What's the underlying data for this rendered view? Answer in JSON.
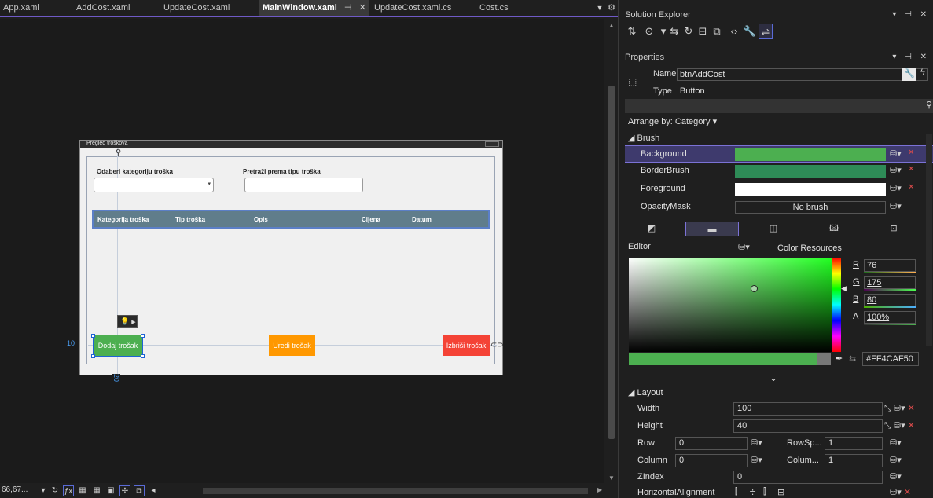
{
  "tabs": [
    {
      "label": "App.xaml"
    },
    {
      "label": "AddCost.xaml"
    },
    {
      "label": "UpdateCost.xaml"
    },
    {
      "label": "MainWindow.xaml",
      "pin": "⊣",
      "close": "✕",
      "active": true
    },
    {
      "label": "UpdateCost.xaml.cs"
    },
    {
      "label": "Cost.cs"
    }
  ],
  "designer": {
    "window_title": "Pregled troškova",
    "combo_label": "Odaberi kategoriju troška",
    "search_label": "Pretraži prema tipu troška",
    "columns": [
      "Kategorija troška",
      "Tip troška",
      "Opis",
      "Cijena",
      "Datum"
    ],
    "buttons": {
      "add": "Dodaj trošak",
      "edit": "Uredi trošak",
      "delete": "Izbriši trošak"
    },
    "margin_left": "10",
    "margin_bottom": "20"
  },
  "statusbar": {
    "zoom": "66,67..."
  },
  "solution_explorer": {
    "title": "Solution Explorer"
  },
  "properties": {
    "title": "Properties",
    "name_label": "Name",
    "name_value": "btnAddCost",
    "type_label": "Type",
    "type_value": "Button",
    "arrange": "Arrange by: Category",
    "brush_category": "◢ Brush",
    "brush_rows": [
      {
        "label": "Background",
        "color": "#4caf50",
        "selected": true
      },
      {
        "label": "BorderBrush",
        "color": "#2e8b57"
      },
      {
        "label": "Foreground",
        "color": "#ffffff"
      },
      {
        "label": "OpacityMask",
        "text": "No brush"
      }
    ],
    "editor": {
      "label": "Editor",
      "resources": "Color Resources",
      "r_label": "R",
      "r": "76",
      "g_label": "G",
      "g": "175",
      "b_label": "B",
      "b": "80",
      "a_label": "A",
      "a": "100%",
      "hex": "#FF4CAF50"
    },
    "layout_category": "◢ Layout",
    "width_label": "Width",
    "width": "100",
    "height_label": "Height",
    "height": "40",
    "row_label": "Row",
    "row": "0",
    "rowspan_label": "RowSp...",
    "rowspan": "1",
    "column_label": "Column",
    "column": "0",
    "colspan_label": "Colum...",
    "colspan": "1",
    "zindex_label": "ZIndex",
    "zindex": "0",
    "halign_label": "HorizontalAlignment"
  },
  "colors": {
    "accent": "#6f5ac7",
    "add": "#4caf50",
    "edit": "#ff9800",
    "delete": "#f44336",
    "grid_header": "#607d8b"
  }
}
